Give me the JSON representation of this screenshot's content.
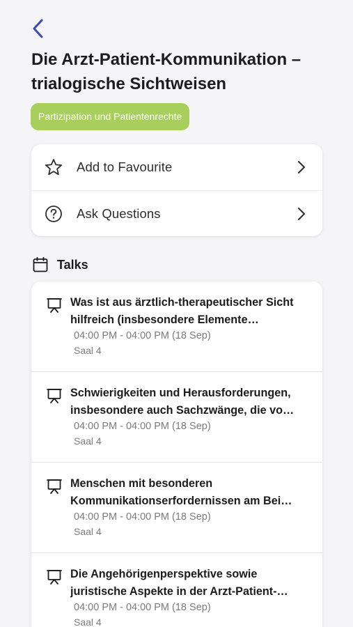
{
  "header": {
    "back_icon": "chevron-left-icon",
    "title": "Die Arzt-Patient-Kommunikation – trialogische Sichtweisen",
    "tag": "Partizipation und Patientenrechte"
  },
  "actions": [
    {
      "label": "Add to Favourite",
      "icon": "star-icon"
    },
    {
      "label": "Ask Questions",
      "icon": "question-circle-icon"
    }
  ],
  "talks_section": {
    "title": "Talks",
    "icon": "calendar-icon",
    "items": [
      {
        "title": "Was ist aus ärztlich-therapeutischer Sicht hilfreich (insbesondere Elemente…",
        "time": "04:00 PM - 04:00 PM (18 Sep)",
        "room": "Saal 4"
      },
      {
        "title": "Schwierigkeiten und Herausforderungen, insbesondere auch Sachzwänge, die vo…",
        "time": "04:00 PM - 04:00 PM (18 Sep)",
        "room": "Saal 4"
      },
      {
        "title": "Menschen mit besonderen Kommunikationserfordernissen am Bei…",
        "time": "04:00 PM - 04:00 PM (18 Sep)",
        "room": "Saal 4"
      },
      {
        "title": "Die Angehörigenperspektive sowie juristische Aspekte in der Arzt-Patient-…",
        "time": "04:00 PM - 04:00 PM (18 Sep)",
        "room": "Saal 4"
      }
    ]
  },
  "colors": {
    "accent": "#3b4bb0",
    "tag_bg": "#a8cf5c",
    "background": "#f5f5f7"
  }
}
